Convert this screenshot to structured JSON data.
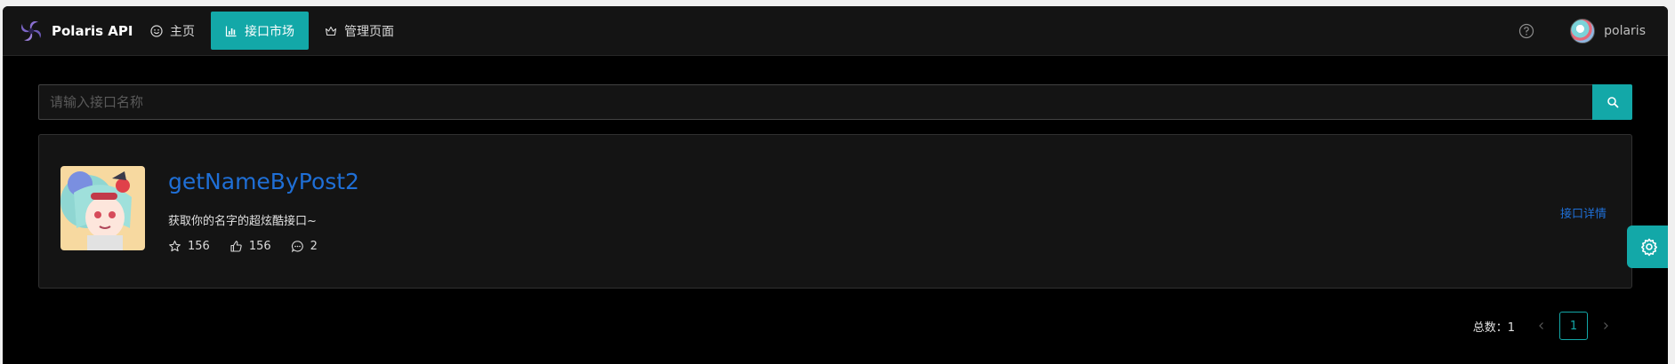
{
  "app": {
    "title": "Polaris API"
  },
  "nav": [
    {
      "label": "主页",
      "icon": "smile-icon"
    },
    {
      "label": "接口市场",
      "icon": "bar-chart-icon",
      "active": true
    },
    {
      "label": "管理页面",
      "icon": "crown-icon"
    }
  ],
  "user": {
    "name": "polaris"
  },
  "search": {
    "placeholder": "请输入接口名称",
    "value": ""
  },
  "api_list": [
    {
      "name": "getNameByPost2",
      "description": "获取你的名字的超炫酷接口~",
      "stars": "156",
      "likes": "156",
      "comments": "2",
      "detail_label": "接口详情"
    }
  ],
  "pagination": {
    "total_label": "总数：1",
    "current_page": "1"
  },
  "colors": {
    "accent": "#13a8a8",
    "link": "#1f6fd6",
    "background": "#000000",
    "header": "#141414"
  }
}
